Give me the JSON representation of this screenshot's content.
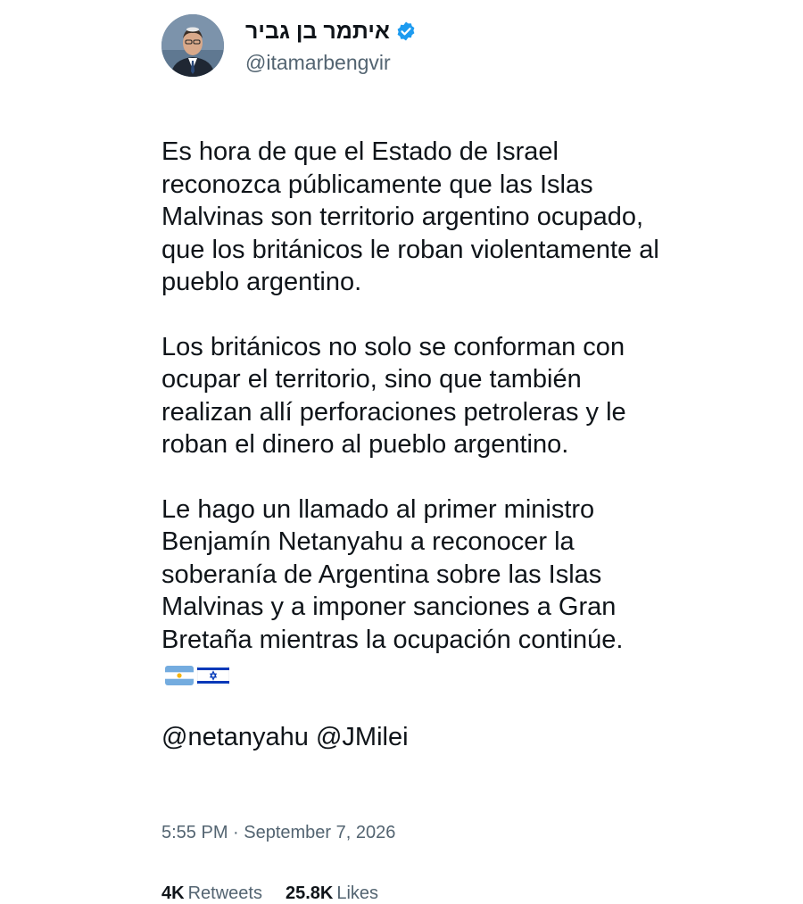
{
  "author": {
    "display_name": "איתמר בן גביר",
    "handle": "@itamarbengvir",
    "verified_icon": "verified-badge-icon",
    "verified_color": "#1d9bf0"
  },
  "tweet": {
    "paragraph_1": "Es hora de que el Estado de Israel reconozca públicamente que las Islas Malvinas son territorio argentino ocupado, que los británicos le roban violentamente al pueblo argentino.",
    "paragraph_2": "Los británicos no solo se conforman con ocupar el territorio, sino que también realizan allí perforaciones petroleras y le roban el dinero al pueblo argentino.",
    "paragraph_3": "Le hago un llamado al primer ministro Benjamín Netanyahu a reconocer la soberanía de Argentina sobre las Islas Malvinas y a imponer sanciones a Gran Bretaña mientras la ocupación continúe.",
    "flags": [
      "argentina-flag-icon",
      "israel-flag-icon"
    ],
    "mention_1": "@netanyahu",
    "mention_2": "@JMilei"
  },
  "timestamp": "5:55 PM · September 7, 2026",
  "stats": {
    "retweets_count": "4K",
    "retweets_label": "Retweets",
    "likes_count": "25.8K",
    "likes_label": "Likes"
  },
  "colors": {
    "text_primary": "#0f1419",
    "text_secondary": "#536471",
    "argentina_blue": "#74acdf",
    "israel_blue": "#0038b8"
  }
}
